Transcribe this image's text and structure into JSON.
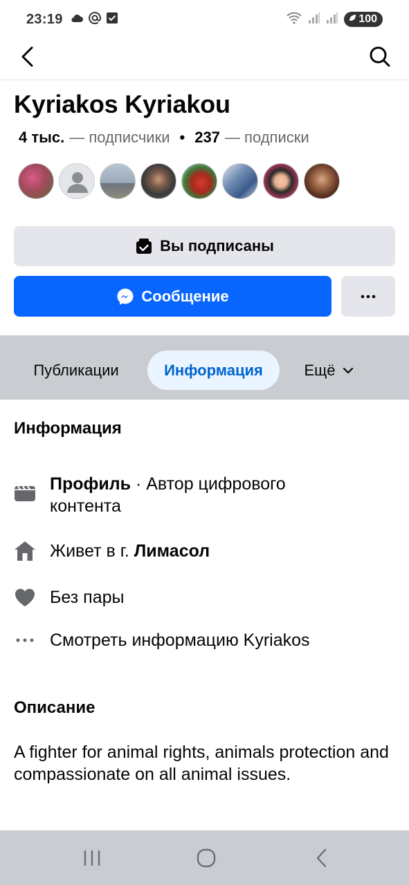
{
  "status": {
    "time": "23:19",
    "battery": "100",
    "left_icons": [
      "cloud-icon",
      "at-icon",
      "checkbox-icon"
    ],
    "right_icons": [
      "wifi-icon",
      "signal-icon",
      "signal-roaming-icon"
    ]
  },
  "topbar": {
    "back_icon": "chevron-left-icon",
    "search_icon": "search-icon"
  },
  "profile": {
    "name": "Kyriakos Kyriakou",
    "followers_count": "4 тыс.",
    "followers_label": "— подписчики",
    "following_count": "237",
    "following_label": "— подписки",
    "separator": "•"
  },
  "friend_avatars": [
    {
      "name": "friend-avatar-1",
      "color": "#a14a5a"
    },
    {
      "name": "friend-avatar-2",
      "color": "#d4d6d9"
    },
    {
      "name": "friend-avatar-3",
      "color": "#8fa3b5"
    },
    {
      "name": "friend-avatar-4",
      "color": "#4a4a4a"
    },
    {
      "name": "friend-avatar-5",
      "color": "#c0392b"
    },
    {
      "name": "friend-avatar-6",
      "color": "#6e8bb0"
    },
    {
      "name": "friend-avatar-7",
      "color": "#b33a5e"
    },
    {
      "name": "friend-avatar-8",
      "color": "#7a4a2c"
    }
  ],
  "actions": {
    "subscribed_label": "Вы подписаны",
    "message_label": "Сообщение",
    "more_label": "···"
  },
  "tabs": {
    "posts": "Публикации",
    "info": "Информация",
    "more": "Ещё"
  },
  "info_section": {
    "title": "Информация",
    "profile_bold": "Профиль",
    "profile_rest_line1": " · Автор цифрового",
    "profile_rest_line2": "контента",
    "lives_prefix": "Живет в г. ",
    "lives_city": "Лимасол",
    "relationship": "Без пары",
    "see_info": "Смотреть информацию Kyriakos"
  },
  "description_section": {
    "title": "Описание",
    "text": "A fighter for animal rights, animals protection and compassionate on all animal issues."
  },
  "colors": {
    "accent": "#0866ff",
    "tab_active_bg": "#ebf5ff",
    "tab_active_text": "#0064d1",
    "button_gray": "#e4e6eb",
    "muted_text": "#65676b",
    "bar_gray": "#c9ccd1"
  }
}
